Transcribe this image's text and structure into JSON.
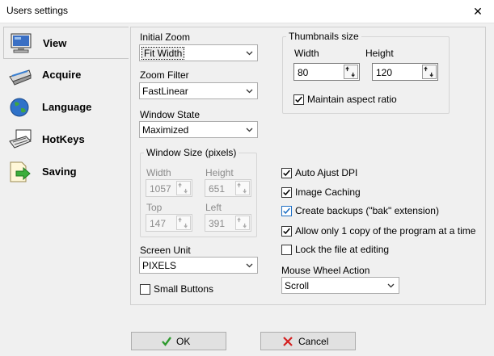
{
  "window": {
    "title": "Users settings",
    "close_glyph": "✕"
  },
  "sidebar": {
    "items": [
      {
        "label": "View",
        "icon": "monitor-icon"
      },
      {
        "label": "Acquire",
        "icon": "scanner-icon"
      },
      {
        "label": "Language",
        "icon": "globe-icon"
      },
      {
        "label": "HotKeys",
        "icon": "keyboard-icon"
      },
      {
        "label": "Saving",
        "icon": "save-arrow-icon"
      }
    ]
  },
  "view": {
    "initial_zoom": {
      "label": "Initial Zoom",
      "value": "Fit Width"
    },
    "zoom_filter": {
      "label": "Zoom Filter",
      "value": "FastLinear"
    },
    "window_state": {
      "label": "Window State",
      "value": "Maximized"
    },
    "window_size": {
      "title": "Window Size (pixels)",
      "width_label": "Width",
      "width_value": "1057",
      "height_label": "Height",
      "height_value": "651",
      "top_label": "Top",
      "top_value": "147",
      "left_label": "Left",
      "left_value": "391"
    },
    "screen_unit": {
      "label": "Screen Unit",
      "value": "PIXELS"
    },
    "small_buttons": {
      "label": "Small Buttons",
      "checked": false
    },
    "thumbnails": {
      "title": "Thumbnails size",
      "width_label": "Width",
      "width_value": "80",
      "height_label": "Height",
      "height_value": "120",
      "maintain_label": "Maintain aspect ratio",
      "maintain_checked": true
    },
    "options": [
      {
        "label": "Auto Ajust DPI",
        "checked": true
      },
      {
        "label": "Image Caching",
        "checked": true
      },
      {
        "label": "Create backups (\"bak\" extension)",
        "checked": true
      },
      {
        "label": "Allow only 1 copy of the program at a time",
        "checked": true
      },
      {
        "label": "Lock the file at editing",
        "checked": false
      }
    ],
    "mouse_wheel": {
      "label": "Mouse Wheel Action",
      "value": "Scroll"
    }
  },
  "buttons": {
    "ok": "OK",
    "cancel": "Cancel"
  },
  "colors": {
    "ok_check": "#2e9a2e",
    "cancel_x": "#d42020",
    "focus_check": "#1f6fc4"
  }
}
